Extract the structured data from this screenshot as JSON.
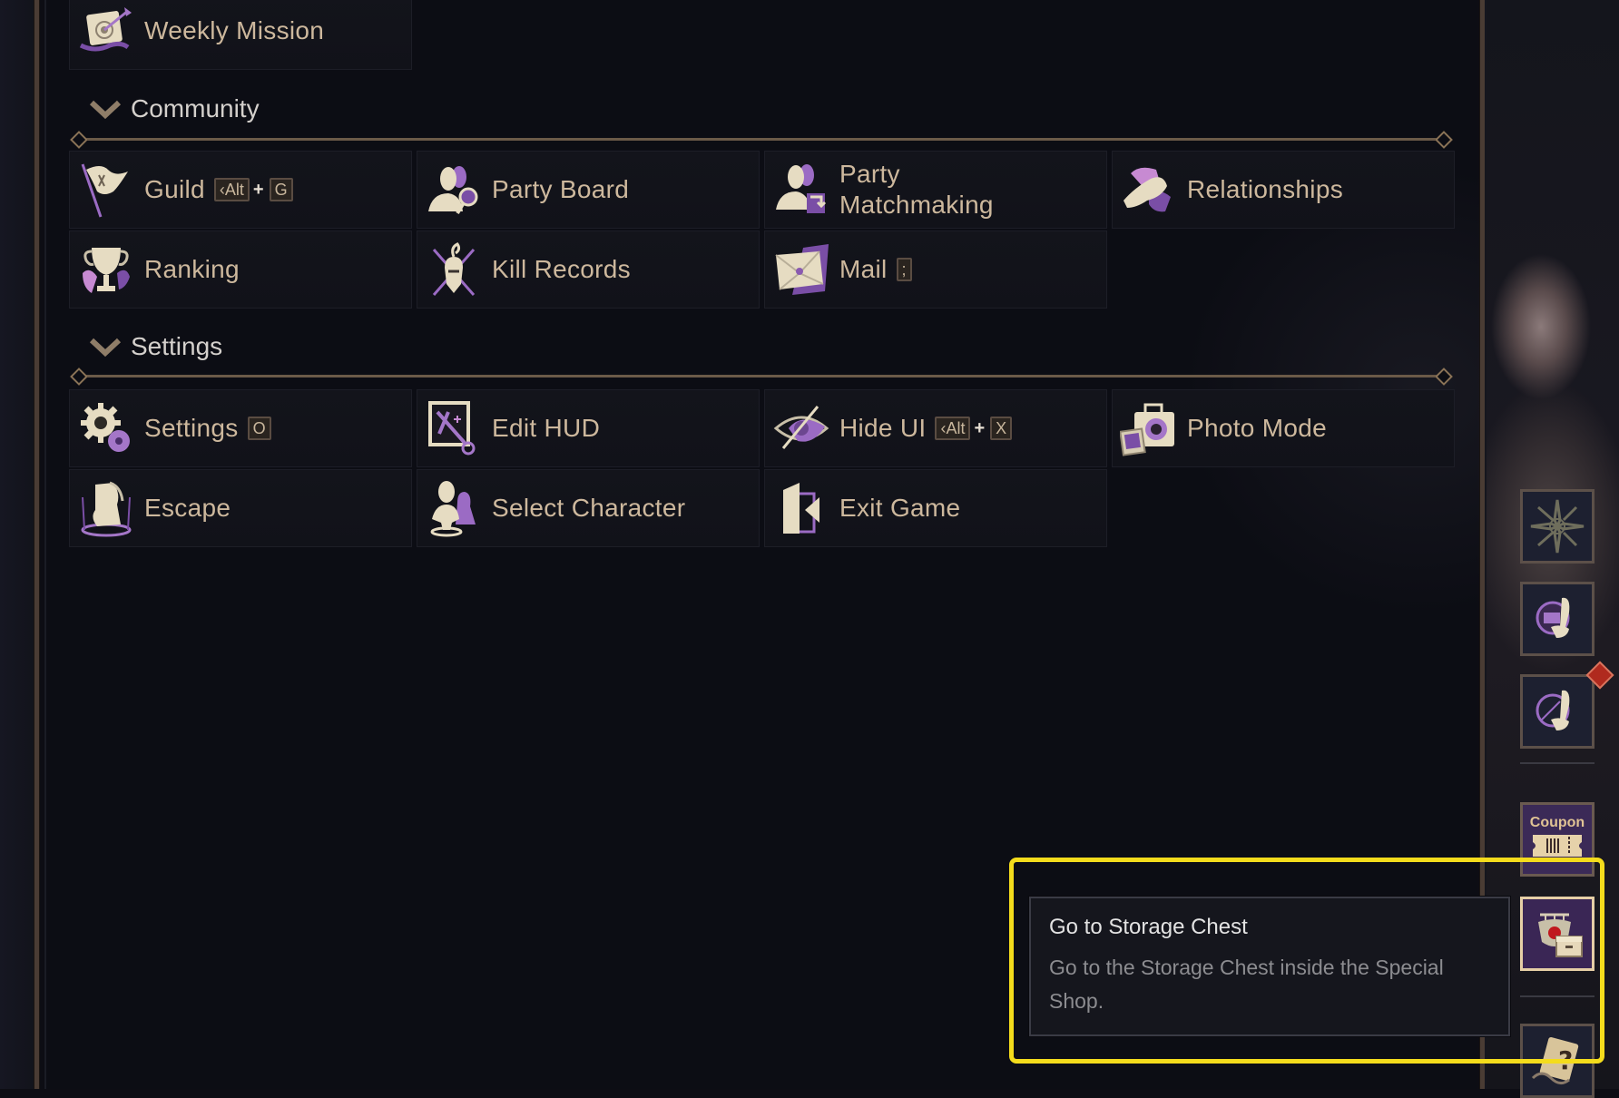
{
  "sections": {
    "top": {
      "items": [
        {
          "label": "Weekly Mission",
          "icon": "weekly-mission-icon"
        }
      ]
    },
    "community": {
      "title": "Community",
      "items": [
        {
          "label": "Guild",
          "icon": "guild-flag-icon",
          "shortcut": {
            "modifier": "Alt",
            "key": "G"
          }
        },
        {
          "label": "Party Board",
          "icon": "party-board-icon"
        },
        {
          "label": "Party Matchmaking",
          "icon": "party-matchmaking-icon"
        },
        {
          "label": "Relationships",
          "icon": "handshake-icon"
        },
        {
          "label": "Ranking",
          "icon": "trophy-icon"
        },
        {
          "label": "Kill Records",
          "icon": "kill-records-icon"
        },
        {
          "label": "Mail",
          "icon": "mail-icon",
          "shortcut": {
            "key": ";"
          }
        }
      ]
    },
    "settings": {
      "title": "Settings",
      "items": [
        {
          "label": "Settings",
          "icon": "gear-icon",
          "shortcut": {
            "key": "O"
          }
        },
        {
          "label": "Edit HUD",
          "icon": "edit-hud-icon"
        },
        {
          "label": "Hide UI",
          "icon": "hide-eye-icon",
          "shortcut": {
            "modifier": "Alt",
            "key": "X"
          }
        },
        {
          "label": "Photo Mode",
          "icon": "camera-icon"
        },
        {
          "label": "Escape",
          "icon": "escape-boot-icon"
        },
        {
          "label": "Select Character",
          "icon": "select-character-icon"
        },
        {
          "label": "Exit Game",
          "icon": "exit-door-icon"
        }
      ]
    }
  },
  "shortcut_plus": "+",
  "side_buttons": [
    {
      "name": "compass-sun-button",
      "icon": "sun-emblem-icon"
    },
    {
      "name": "shop-fan-button",
      "icon": "shop-fan-icon"
    },
    {
      "name": "fan-button",
      "icon": "fan-icon",
      "notification": true
    },
    {
      "name": "coupon-button",
      "icon": "coupon-ticket-icon",
      "label": "Coupon"
    },
    {
      "name": "storage-chest-button",
      "icon": "storage-chest-icon",
      "active": true
    },
    {
      "name": "help-button",
      "icon": "help-card-icon"
    }
  ],
  "tooltip": {
    "title": "Go to Storage Chest",
    "body": "Go to the Storage Chest inside the Special Shop."
  },
  "colors": {
    "label_text": "#cdb89d",
    "header_text": "#d4d0cc",
    "divider": "#6b5a48",
    "accent_purple": "#9b6bc4",
    "highlight_yellow": "#f4dc1c",
    "notification_red": "#b02a1e"
  }
}
